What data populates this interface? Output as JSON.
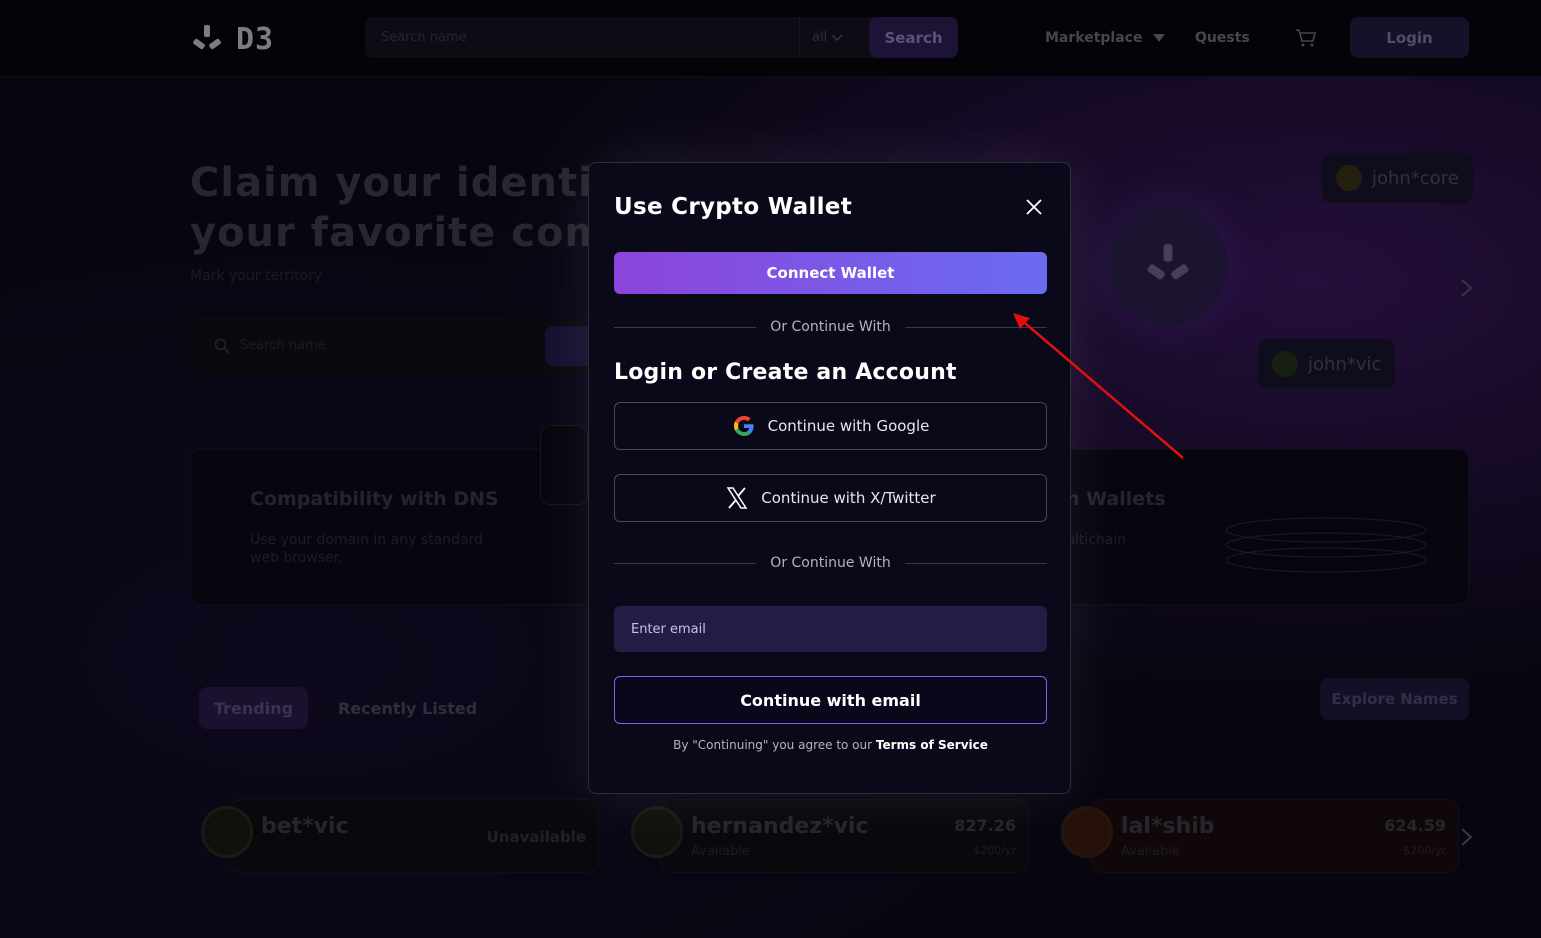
{
  "header": {
    "logo_text": "D3",
    "search_placeholder": "Search name",
    "search_filter": "all",
    "search_button": "Search",
    "nav": [
      "Marketplace",
      "Quests"
    ],
    "login_button": "Login"
  },
  "hero": {
    "title_line1": "Claim your identity",
    "title_line2": "your favorite comm",
    "subtitle": "Mark your territory",
    "search_placeholder": "Search name",
    "tags": [
      "john*core",
      "john*vic"
    ]
  },
  "features": [
    {
      "title": "Compatibility with DNS",
      "desc_line1": "Use your domain in any standard",
      "desc_line2": "web browser."
    },
    {
      "title": "n Wallets",
      "desc": "ultichain"
    }
  ],
  "tabs": [
    "Trending",
    "Recently Listed"
  ],
  "explore_button": "Explore Names",
  "listings": [
    {
      "name": "bet*vic",
      "status": "Unavailable"
    },
    {
      "name": "hernandez*vic",
      "status": "Available",
      "price": "827.26",
      "per_year": "$200/yr"
    },
    {
      "name": "lal*shib",
      "status": "Available",
      "price": "624.59",
      "per_year": "$200/yr"
    }
  ],
  "modal": {
    "title": "Use Crypto Wallet",
    "connect_wallet": "Connect Wallet",
    "divider_text": "Or Continue With",
    "subtitle": "Login or Create an Account",
    "google_button": "Continue with Google",
    "twitter_button": "Continue with X/Twitter",
    "email_placeholder": "Enter email",
    "email_button": "Continue with email",
    "terms_prefix": "By \"Continuing\" you agree to our",
    "terms_link": "Terms of Service"
  },
  "colors": {
    "accent_gradient_start": "#8c44dc",
    "accent_gradient_end": "#6a6cf0",
    "annotation_arrow": "#e01010"
  }
}
